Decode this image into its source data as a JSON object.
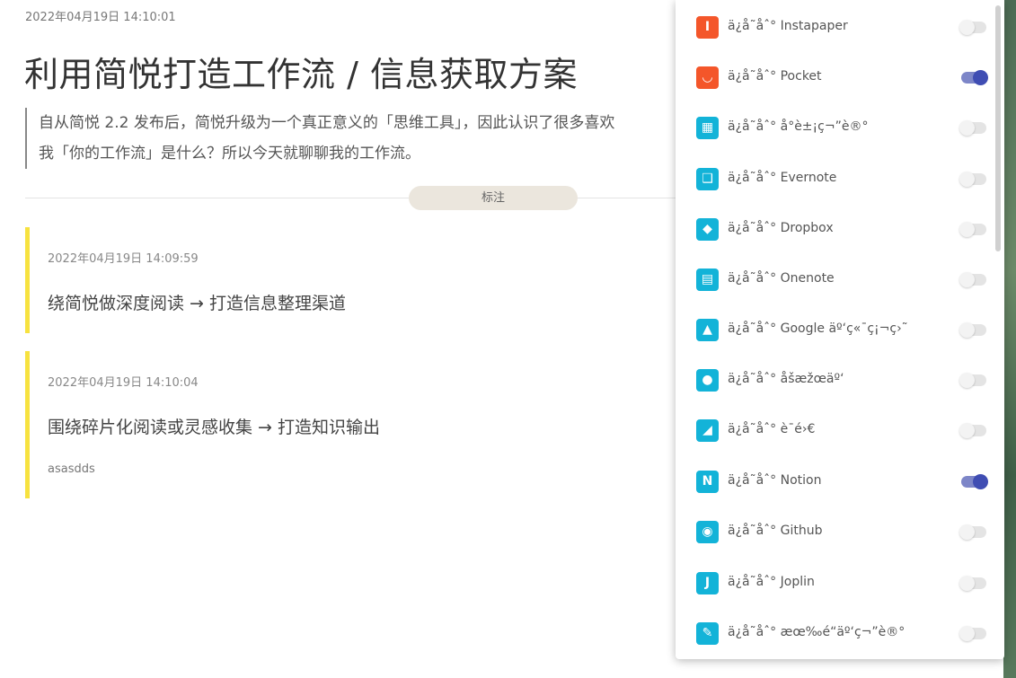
{
  "article": {
    "timestamp": "2022年04月19日 14:10:01",
    "title": "利用简悦打造工作流 / 信息获取方案",
    "summary_line1": "自从简悦 2.2 发布后，简悦升级为一个真正意义的「思维工具」，因此认识了很多喜欢",
    "summary_line2": "我「你的工作流」是什么？所以今天就聊聊我的工作流。",
    "section_label": "标注",
    "annotations": [
      {
        "time": "2022年04月19日 14:09:59",
        "text": "绕简悦做深度阅读 → 打造信息整理渠道",
        "note": ""
      },
      {
        "time": "2022年04月19日 14:10:04",
        "text": "围绕碎片化阅读或灵感收集 → 打造知识输出",
        "note": "asasdds"
      }
    ]
  },
  "export_panel": {
    "items": [
      {
        "label": "ä¿å­˜åˆ° Instapaper",
        "icon": "instapaper-icon",
        "glyph": "I",
        "color": "#f4562a",
        "enabled": false
      },
      {
        "label": "ä¿å­˜åˆ° Pocket",
        "icon": "pocket-icon",
        "glyph": "◡",
        "color": "#f4562a",
        "enabled": true
      },
      {
        "label": "ä¿å­˜åˆ° å°è±¡ç¬”è®°",
        "icon": "yinxiang-icon",
        "glyph": "▦",
        "color": "#13b3d8",
        "enabled": false
      },
      {
        "label": "ä¿å­˜åˆ° Evernote",
        "icon": "evernote-icon",
        "glyph": "❑",
        "color": "#13b3d8",
        "enabled": false
      },
      {
        "label": "ä¿å­˜åˆ° Dropbox",
        "icon": "dropbox-icon",
        "glyph": "◆",
        "color": "#13b3d8",
        "enabled": false
      },
      {
        "label": "ä¿å­˜åˆ° Onenote",
        "icon": "onenote-icon",
        "glyph": "▤",
        "color": "#13b3d8",
        "enabled": false
      },
      {
        "label": "ä¿å­˜åˆ° Google äº‘ç«¯ç¡¬ç›˜",
        "icon": "google-drive-icon",
        "glyph": "▲",
        "color": "#13b3d8",
        "enabled": false
      },
      {
        "label": "ä¿å­˜åˆ° åšæžœäº‘",
        "icon": "jianguoyun-icon",
        "glyph": "●",
        "color": "#13b3d8",
        "enabled": false
      },
      {
        "label": "ä¿å­˜åˆ° è¯­é›€",
        "icon": "yuque-icon",
        "glyph": "◢",
        "color": "#13b3d8",
        "enabled": false
      },
      {
        "label": "ä¿å­˜åˆ° Notion",
        "icon": "notion-icon",
        "glyph": "N",
        "color": "#13b3d8",
        "enabled": true
      },
      {
        "label": "ä¿å­˜åˆ° Github",
        "icon": "github-icon",
        "glyph": "◉",
        "color": "#13b3d8",
        "enabled": false
      },
      {
        "label": "ä¿å­˜åˆ° Joplin",
        "icon": "joplin-icon",
        "glyph": "J",
        "color": "#13b3d8",
        "enabled": false
      },
      {
        "label": "ä¿å­˜åˆ° æœ‰é“äº‘ç¬”è®°",
        "icon": "youdao-note-icon",
        "glyph": "✎",
        "color": "#13b3d8",
        "enabled": false
      }
    ]
  }
}
